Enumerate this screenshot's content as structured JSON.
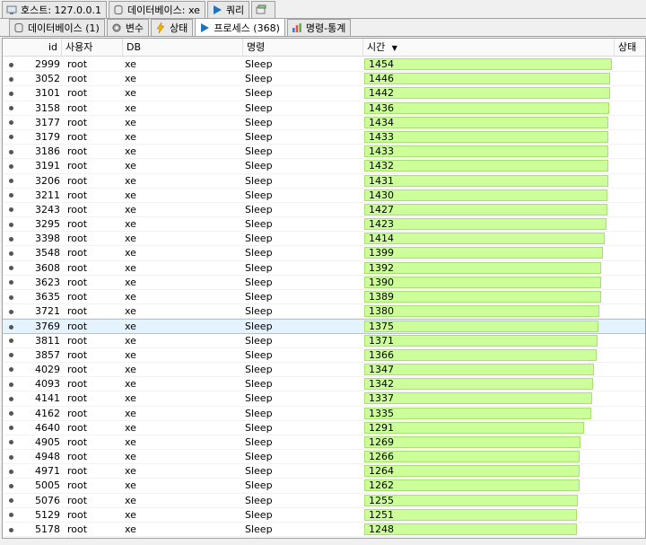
{
  "top_tabs": [
    {
      "label": "호스트: 127.0.0.1",
      "icon": "host-icon"
    },
    {
      "label": "데이터베이스: xe",
      "icon": "database-icon"
    },
    {
      "label": "쿼리",
      "icon": "play-icon"
    },
    {
      "label": "",
      "icon": "new-query-icon"
    }
  ],
  "sub_tabs": [
    {
      "label": "데이터베이스 (1)",
      "icon": "database-icon"
    },
    {
      "label": "변수",
      "icon": "gear-icon"
    },
    {
      "label": "상태",
      "icon": "lightning-icon"
    },
    {
      "label": "프로세스 (368)",
      "icon": "play-icon",
      "active": true
    },
    {
      "label": "명령-통계",
      "icon": "bar-chart-icon"
    }
  ],
  "columns": {
    "id": "id",
    "user": "사용자",
    "db": "DB",
    "command": "명령",
    "time": "시간",
    "state": "상태"
  },
  "sort_indicator": "▼",
  "time_max": 1454,
  "bar_color": "#ccff99",
  "selected_row_id": "3769",
  "rows": [
    {
      "id": "2999",
      "user": "root",
      "db": "xe",
      "command": "Sleep",
      "time": "1454"
    },
    {
      "id": "3052",
      "user": "root",
      "db": "xe",
      "command": "Sleep",
      "time": "1446"
    },
    {
      "id": "3101",
      "user": "root",
      "db": "xe",
      "command": "Sleep",
      "time": "1442"
    },
    {
      "id": "3158",
      "user": "root",
      "db": "xe",
      "command": "Sleep",
      "time": "1436"
    },
    {
      "id": "3177",
      "user": "root",
      "db": "xe",
      "command": "Sleep",
      "time": "1434"
    },
    {
      "id": "3179",
      "user": "root",
      "db": "xe",
      "command": "Sleep",
      "time": "1433"
    },
    {
      "id": "3186",
      "user": "root",
      "db": "xe",
      "command": "Sleep",
      "time": "1433"
    },
    {
      "id": "3191",
      "user": "root",
      "db": "xe",
      "command": "Sleep",
      "time": "1432"
    },
    {
      "id": "3206",
      "user": "root",
      "db": "xe",
      "command": "Sleep",
      "time": "1431"
    },
    {
      "id": "3211",
      "user": "root",
      "db": "xe",
      "command": "Sleep",
      "time": "1430"
    },
    {
      "id": "3243",
      "user": "root",
      "db": "xe",
      "command": "Sleep",
      "time": "1427"
    },
    {
      "id": "3295",
      "user": "root",
      "db": "xe",
      "command": "Sleep",
      "time": "1423"
    },
    {
      "id": "3398",
      "user": "root",
      "db": "xe",
      "command": "Sleep",
      "time": "1414"
    },
    {
      "id": "3548",
      "user": "root",
      "db": "xe",
      "command": "Sleep",
      "time": "1399"
    },
    {
      "id": "3608",
      "user": "root",
      "db": "xe",
      "command": "Sleep",
      "time": "1392"
    },
    {
      "id": "3623",
      "user": "root",
      "db": "xe",
      "command": "Sleep",
      "time": "1390"
    },
    {
      "id": "3635",
      "user": "root",
      "db": "xe",
      "command": "Sleep",
      "time": "1389"
    },
    {
      "id": "3721",
      "user": "root",
      "db": "xe",
      "command": "Sleep",
      "time": "1380"
    },
    {
      "id": "3769",
      "user": "root",
      "db": "xe",
      "command": "Sleep",
      "time": "1375"
    },
    {
      "id": "3811",
      "user": "root",
      "db": "xe",
      "command": "Sleep",
      "time": "1371"
    },
    {
      "id": "3857",
      "user": "root",
      "db": "xe",
      "command": "Sleep",
      "time": "1366"
    },
    {
      "id": "4029",
      "user": "root",
      "db": "xe",
      "command": "Sleep",
      "time": "1347"
    },
    {
      "id": "4093",
      "user": "root",
      "db": "xe",
      "command": "Sleep",
      "time": "1342"
    },
    {
      "id": "4141",
      "user": "root",
      "db": "xe",
      "command": "Sleep",
      "time": "1337"
    },
    {
      "id": "4162",
      "user": "root",
      "db": "xe",
      "command": "Sleep",
      "time": "1335"
    },
    {
      "id": "4640",
      "user": "root",
      "db": "xe",
      "command": "Sleep",
      "time": "1291"
    },
    {
      "id": "4905",
      "user": "root",
      "db": "xe",
      "command": "Sleep",
      "time": "1269"
    },
    {
      "id": "4948",
      "user": "root",
      "db": "xe",
      "command": "Sleep",
      "time": "1266"
    },
    {
      "id": "4971",
      "user": "root",
      "db": "xe",
      "command": "Sleep",
      "time": "1264"
    },
    {
      "id": "5005",
      "user": "root",
      "db": "xe",
      "command": "Sleep",
      "time": "1262"
    },
    {
      "id": "5076",
      "user": "root",
      "db": "xe",
      "command": "Sleep",
      "time": "1255"
    },
    {
      "id": "5129",
      "user": "root",
      "db": "xe",
      "command": "Sleep",
      "time": "1251"
    },
    {
      "id": "5178",
      "user": "root",
      "db": "xe",
      "command": "Sleep",
      "time": "1248"
    }
  ]
}
